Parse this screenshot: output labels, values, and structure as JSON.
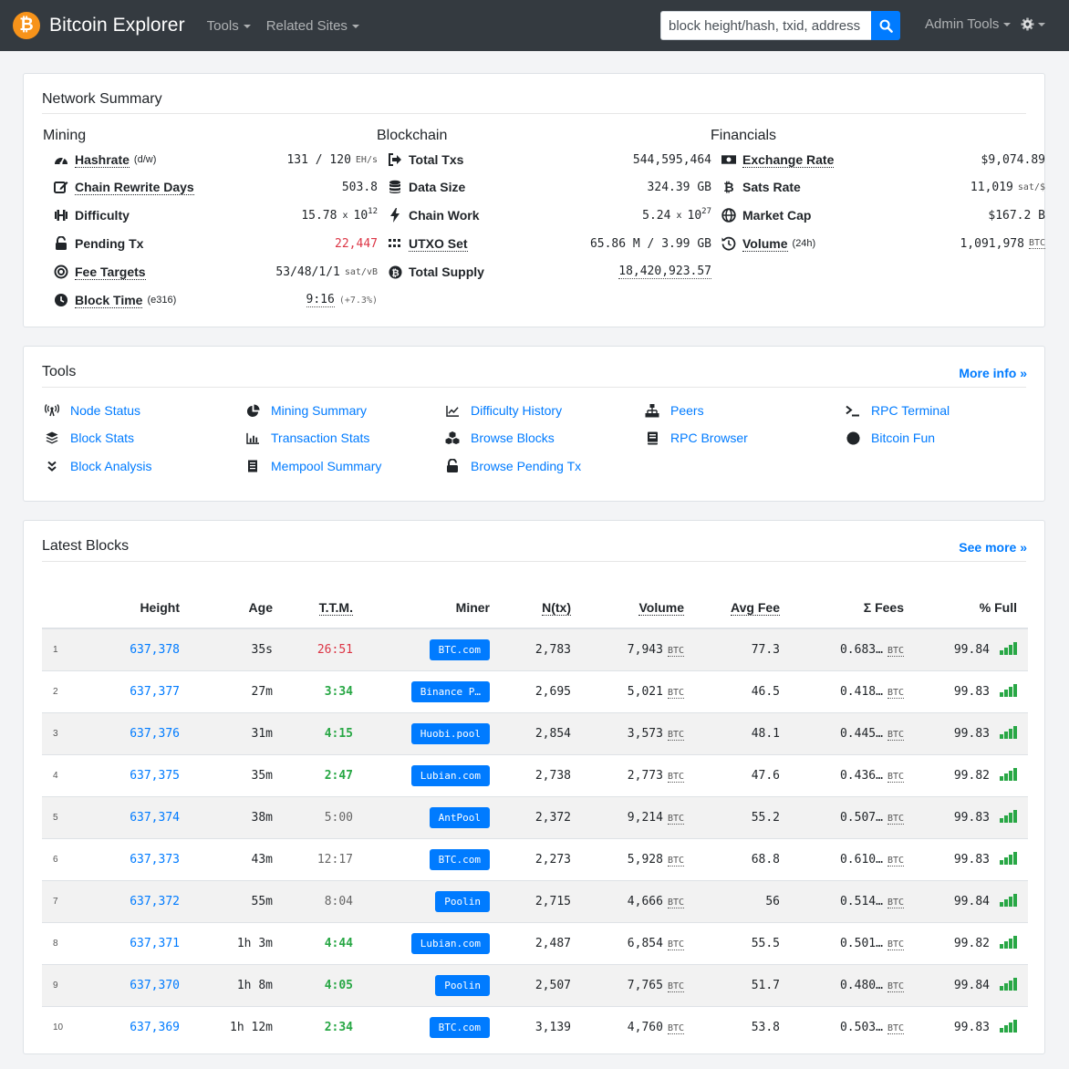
{
  "brand": {
    "logo_glyph": "₿",
    "name": "Bitcoin Explorer"
  },
  "nav": {
    "tools": "Tools",
    "related": "Related Sites",
    "admin": "Admin Tools"
  },
  "search": {
    "placeholder": "block height/hash, txid, address"
  },
  "network_summary": {
    "title": "Network Summary",
    "mining": {
      "heading": "Mining",
      "hashrate": {
        "label": "Hashrate",
        "sub": "(d/w)",
        "value": "131 / 120",
        "unit": "EH/s"
      },
      "rewrite": {
        "label": "Chain Rewrite Days",
        "value": "503.8"
      },
      "difficulty": {
        "label": "Difficulty",
        "mantissa": "15.78",
        "x": "x",
        "base": "10",
        "exp": "12"
      },
      "pending": {
        "label": "Pending Tx",
        "value": "22,447"
      },
      "fee_targets": {
        "label": "Fee Targets",
        "value": "53/48/1/1",
        "unit": "sat/vB"
      },
      "block_time": {
        "label": "Block Time",
        "sub": "(e316)",
        "value": "9:16",
        "delta": "(+7.3%)"
      }
    },
    "blockchain": {
      "heading": "Blockchain",
      "total_txs": {
        "label": "Total Txs",
        "value": "544,595,464"
      },
      "data_size": {
        "label": "Data Size",
        "value": "324.39 GB"
      },
      "chain_work": {
        "label": "Chain Work",
        "mantissa": "5.24",
        "x": "x",
        "base": "10",
        "exp": "27"
      },
      "utxo": {
        "label": "UTXO Set",
        "value": "65.86 M / 3.99 GB"
      },
      "supply": {
        "label": "Total Supply",
        "value": "18,420,923.57"
      }
    },
    "financials": {
      "heading": "Financials",
      "rate": {
        "label": "Exchange Rate",
        "value": "$9,074.89"
      },
      "sats": {
        "label": "Sats Rate",
        "value": "11,019",
        "unit": "sat/$"
      },
      "cap": {
        "label": "Market Cap",
        "value": "$167.2 B"
      },
      "volume": {
        "label": "Volume",
        "sub": "(24h)",
        "value": "1,091,978",
        "unit": "BTC"
      }
    }
  },
  "tools": {
    "title": "Tools",
    "more": "More info »",
    "items": [
      {
        "label": "Node Status",
        "icon": "broadcast-icon"
      },
      {
        "label": "Mining Summary",
        "icon": "pie-icon"
      },
      {
        "label": "Difficulty History",
        "icon": "line-chart-icon"
      },
      {
        "label": "Peers",
        "icon": "network-icon"
      },
      {
        "label": "RPC Terminal",
        "icon": "terminal-icon"
      },
      {
        "label": "Block Stats",
        "icon": "layers-icon"
      },
      {
        "label": "Transaction Stats",
        "icon": "bar-chart-icon"
      },
      {
        "label": "Browse Blocks",
        "icon": "cubes-icon"
      },
      {
        "label": "RPC Browser",
        "icon": "book-icon"
      },
      {
        "label": "Bitcoin Fun",
        "icon": "certificate-icon"
      },
      {
        "label": "Block Analysis",
        "icon": "chevrons-down-icon"
      },
      {
        "label": "Mempool Summary",
        "icon": "document-icon"
      },
      {
        "label": "Browse Pending Tx",
        "icon": "unlock-icon"
      }
    ]
  },
  "latest_blocks": {
    "title": "Latest Blocks",
    "more": "See more »",
    "columns": [
      "Height",
      "Age",
      "T.T.M.",
      "Miner",
      "N(tx)",
      "Volume",
      "Avg Fee",
      "Σ Fees",
      "% Full"
    ],
    "unit": "BTC",
    "rows": [
      {
        "idx": "1",
        "height": "637,378",
        "age": "35s",
        "ttm": "26:51",
        "ttm_style": "red",
        "miner": "BTC.com",
        "ntx": "2,783",
        "volume": "7,943",
        "avg_fee": "77.3",
        "fees": "0.683…",
        "full": "99.84"
      },
      {
        "idx": "2",
        "height": "637,377",
        "age": "27m",
        "ttm": "3:34",
        "ttm_style": "green",
        "miner": "Binance P…",
        "ntx": "2,695",
        "volume": "5,021",
        "avg_fee": "46.5",
        "fees": "0.418…",
        "full": "99.83"
      },
      {
        "idx": "3",
        "height": "637,376",
        "age": "31m",
        "ttm": "4:15",
        "ttm_style": "green",
        "miner": "Huobi.pool",
        "ntx": "2,854",
        "volume": "3,573",
        "avg_fee": "48.1",
        "fees": "0.445…",
        "full": "99.83"
      },
      {
        "idx": "4",
        "height": "637,375",
        "age": "35m",
        "ttm": "2:47",
        "ttm_style": "green",
        "miner": "Lubian.com",
        "ntx": "2,738",
        "volume": "2,773",
        "avg_fee": "47.6",
        "fees": "0.436…",
        "full": "99.82"
      },
      {
        "idx": "5",
        "height": "637,374",
        "age": "38m",
        "ttm": "5:00",
        "ttm_style": "grey",
        "miner": "AntPool",
        "ntx": "2,372",
        "volume": "9,214",
        "avg_fee": "55.2",
        "fees": "0.507…",
        "full": "99.83"
      },
      {
        "idx": "6",
        "height": "637,373",
        "age": "43m",
        "ttm": "12:17",
        "ttm_style": "grey",
        "miner": "BTC.com",
        "ntx": "2,273",
        "volume": "5,928",
        "avg_fee": "68.8",
        "fees": "0.610…",
        "full": "99.83"
      },
      {
        "idx": "7",
        "height": "637,372",
        "age": "55m",
        "ttm": "8:04",
        "ttm_style": "grey",
        "miner": "Poolin",
        "ntx": "2,715",
        "volume": "4,666",
        "avg_fee": "56",
        "fees": "0.514…",
        "full": "99.84"
      },
      {
        "idx": "8",
        "height": "637,371",
        "age": "1h 3m",
        "ttm": "4:44",
        "ttm_style": "green",
        "miner": "Lubian.com",
        "ntx": "2,487",
        "volume": "6,854",
        "avg_fee": "55.5",
        "fees": "0.501…",
        "full": "99.82"
      },
      {
        "idx": "9",
        "height": "637,370",
        "age": "1h 8m",
        "ttm": "4:05",
        "ttm_style": "green",
        "miner": "Poolin",
        "ntx": "2,507",
        "volume": "7,765",
        "avg_fee": "51.7",
        "fees": "0.480…",
        "full": "99.84"
      },
      {
        "idx": "10",
        "height": "637,369",
        "age": "1h 12m",
        "ttm": "2:34",
        "ttm_style": "green",
        "miner": "BTC.com",
        "ntx": "3,139",
        "volume": "4,760",
        "avg_fee": "53.8",
        "fees": "0.503…",
        "full": "99.83"
      }
    ]
  },
  "colors": {
    "navbar": "#343a40",
    "accent": "#007bff",
    "bitcoin": "#f7931a",
    "green": "#28a745",
    "red": "#dc3545"
  }
}
